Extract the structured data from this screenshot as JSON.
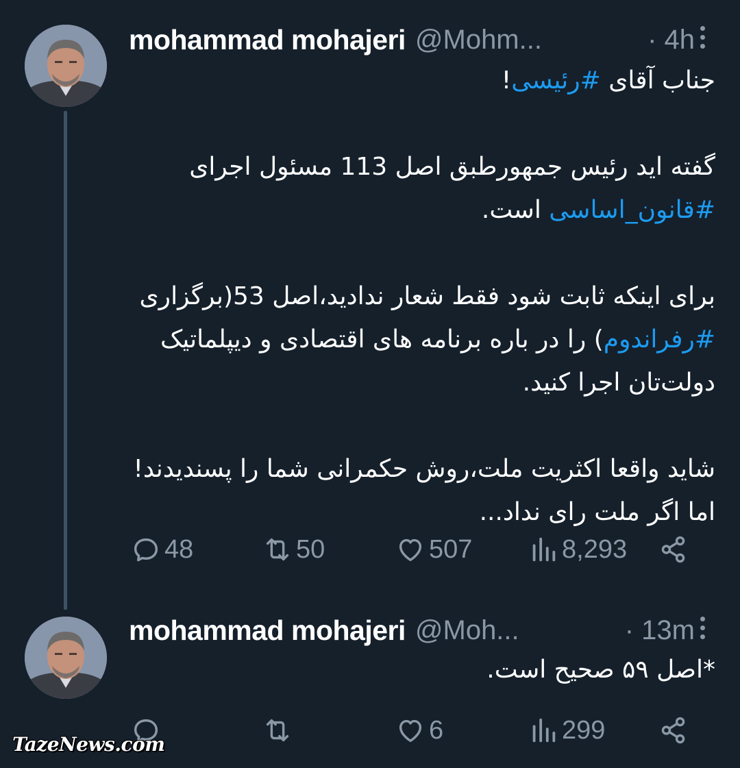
{
  "colors": {
    "background": "#15202b",
    "text_primary": "#ffffff",
    "text_secondary": "#8b98a5",
    "hashtag": "#1d9bf0",
    "thread_line": "#3d5466"
  },
  "tweets": [
    {
      "author_name": "mohammad mohajeri",
      "handle": "@Mohm...",
      "time": "· 4h",
      "paragraphs": [
        [
          {
            "text": "جناب آقای "
          },
          {
            "text": "#رئیسی",
            "hashtag": true
          },
          {
            "text": "!"
          }
        ],
        [
          {
            "text": "گفته اید رئیس جمهورطبق اصل 113 مسئول اجرای "
          },
          {
            "text": "#قانون_اساسی",
            "hashtag": true
          },
          {
            "text": " است."
          }
        ],
        [
          {
            "text": "برای اینکه ثابت شود فقط شعار ندادید،اصل 53(برگزاری "
          },
          {
            "text": "#رفراندوم",
            "hashtag": true
          },
          {
            "text": ") را در باره برنامه های اقتصادی و دیپلماتیک دولت‌تان اجرا کنید."
          }
        ],
        [
          {
            "text": "شاید واقعا اکثریت ملت،روش حکمرانی شما را پسندیدند! اما اگر ملت رای نداد..."
          }
        ]
      ],
      "stats": {
        "replies": "48",
        "retweets": "50",
        "likes": "507",
        "views": "8,293"
      },
      "icons": [
        "reply-icon",
        "retweet-icon",
        "like-icon",
        "views-icon",
        "share-icon",
        "more-icon"
      ]
    },
    {
      "author_name": "mohammad mohajeri",
      "handle": "@Moh...",
      "time": "· 13m",
      "paragraphs": [
        [
          {
            "text": "*اصل ۵۹ صحیح است."
          }
        ]
      ],
      "stats": {
        "replies": "",
        "retweets": "",
        "likes": "6",
        "views": "299"
      },
      "icons": [
        "reply-icon",
        "retweet-icon",
        "like-icon",
        "views-icon",
        "share-icon",
        "more-icon"
      ]
    }
  ],
  "watermark": "TazeNews.com"
}
